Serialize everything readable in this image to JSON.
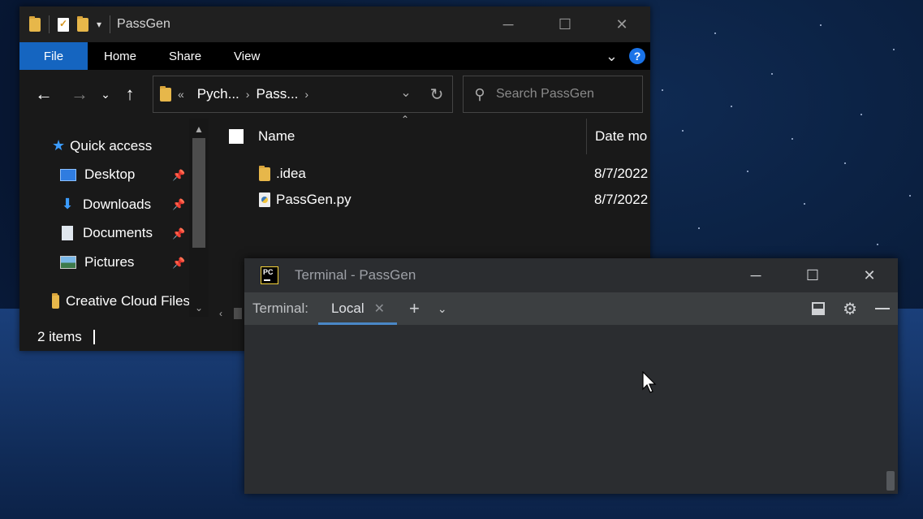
{
  "explorer": {
    "title": "PassGen",
    "ribbon": {
      "file": "File",
      "home": "Home",
      "share": "Share",
      "view": "View",
      "help": "?"
    },
    "address": {
      "overflow": "«",
      "crumb1": "Pych...",
      "crumb2": "Pass..."
    },
    "search": {
      "placeholder": "Search PassGen"
    },
    "nav": {
      "quick_access": "Quick access",
      "desktop": "Desktop",
      "downloads": "Downloads",
      "documents": "Documents",
      "pictures": "Pictures",
      "creative_cloud": "Creative Cloud Files"
    },
    "columns": {
      "name": "Name",
      "date": "Date mo"
    },
    "files": [
      {
        "name": ".idea",
        "date": "8/7/2022",
        "icon": "folder-icon"
      },
      {
        "name": "PassGen.py",
        "date": "8/7/2022",
        "icon": "python-file-icon"
      }
    ],
    "status": {
      "count": "2 items"
    }
  },
  "terminal": {
    "title": "Terminal - PassGen",
    "label": "Terminal:",
    "tab": "Local"
  }
}
